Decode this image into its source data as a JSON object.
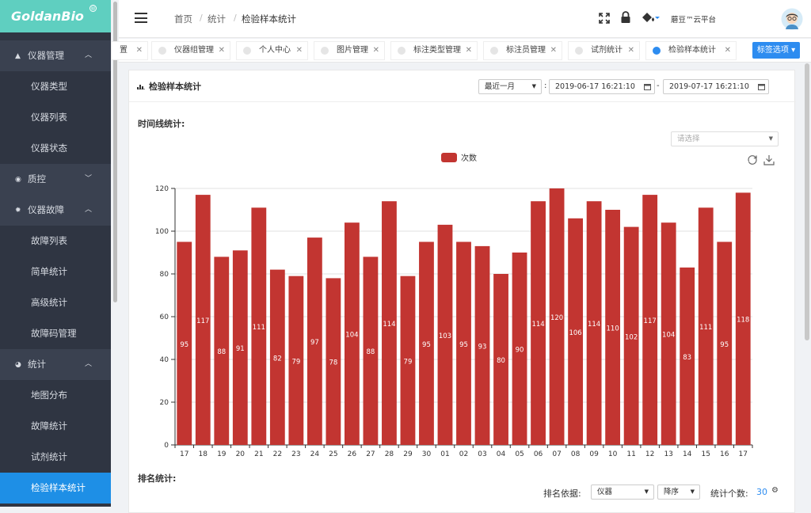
{
  "brand": {
    "name": "GoldanBio",
    "mark": "®"
  },
  "sidebar": {
    "items": [
      {
        "label": "仪器管理",
        "type": "group",
        "icon": "car-icon",
        "open": true
      },
      {
        "label": "仪器类型",
        "type": "sub"
      },
      {
        "label": "仪器列表",
        "type": "sub"
      },
      {
        "label": "仪器状态",
        "type": "sub"
      },
      {
        "label": "质控",
        "type": "group",
        "icon": "target-icon",
        "open": false
      },
      {
        "label": "仪器故障",
        "type": "group",
        "icon": "gear-icon",
        "open": true
      },
      {
        "label": "故障列表",
        "type": "sub"
      },
      {
        "label": "简单统计",
        "type": "sub"
      },
      {
        "label": "高级统计",
        "type": "sub"
      },
      {
        "label": "故障码管理",
        "type": "sub"
      },
      {
        "label": "统计",
        "type": "group",
        "icon": "pie-icon",
        "open": true
      },
      {
        "label": "地图分布",
        "type": "sub"
      },
      {
        "label": "故障统计",
        "type": "sub"
      },
      {
        "label": "试剂统计",
        "type": "sub"
      },
      {
        "label": "检验样本统计",
        "type": "sub",
        "active": true
      }
    ]
  },
  "header": {
    "breadcrumb": [
      "首页",
      "统计",
      "检验样本统计"
    ],
    "sep": "/",
    "user": "蘑豆™云平台"
  },
  "tabs": {
    "items": [
      {
        "label": "置",
        "partial": true
      },
      {
        "label": "仪器组管理"
      },
      {
        "label": "个人中心"
      },
      {
        "label": "图片管理"
      },
      {
        "label": "标注类型管理"
      },
      {
        "label": "标注员管理"
      },
      {
        "label": "试剂统计"
      },
      {
        "label": "检验样本统计",
        "active": true
      }
    ],
    "options_label": "标签选项"
  },
  "card": {
    "title": "检验样本统计",
    "range_select": "最近一月",
    "colon": ":",
    "date_from": "2019-06-17 16:21:10",
    "dash": "-",
    "date_to": "2019-07-17 16:21:10"
  },
  "timeline": {
    "label": "时间线统计:",
    "select_placeholder": "请选择"
  },
  "ranking": {
    "label": "排名统计:",
    "by_label": "排名依据:",
    "by_value": "仪器",
    "order_value": "降序",
    "count_label": "统计个数:",
    "count_value": "30"
  },
  "colors": {
    "bar": "#c23531",
    "accent": "#2d8cf0",
    "sidebar": "#2f3542",
    "brand": "#5fcfc0"
  },
  "chart_data": {
    "type": "bar",
    "categories": [
      "17",
      "18",
      "19",
      "20",
      "21",
      "22",
      "23",
      "24",
      "25",
      "26",
      "27",
      "28",
      "29",
      "30",
      "01",
      "02",
      "03",
      "04",
      "05",
      "06",
      "07",
      "08",
      "09",
      "10",
      "11",
      "12",
      "13",
      "14",
      "15",
      "16",
      "17"
    ],
    "series": [
      {
        "name": "次数",
        "values": [
          95,
          117,
          88,
          91,
          111,
          82,
          79,
          97,
          78,
          104,
          88,
          114,
          79,
          95,
          103,
          95,
          93,
          80,
          90,
          114,
          120,
          106,
          114,
          110,
          102,
          117,
          104,
          83,
          111,
          95,
          118
        ]
      }
    ],
    "yticks": [
      "0",
      "20",
      "40",
      "60",
      "80",
      "100",
      "120"
    ],
    "ylim": [
      0,
      120
    ],
    "grid": true,
    "legend": "top-center",
    "data_labels": true
  }
}
